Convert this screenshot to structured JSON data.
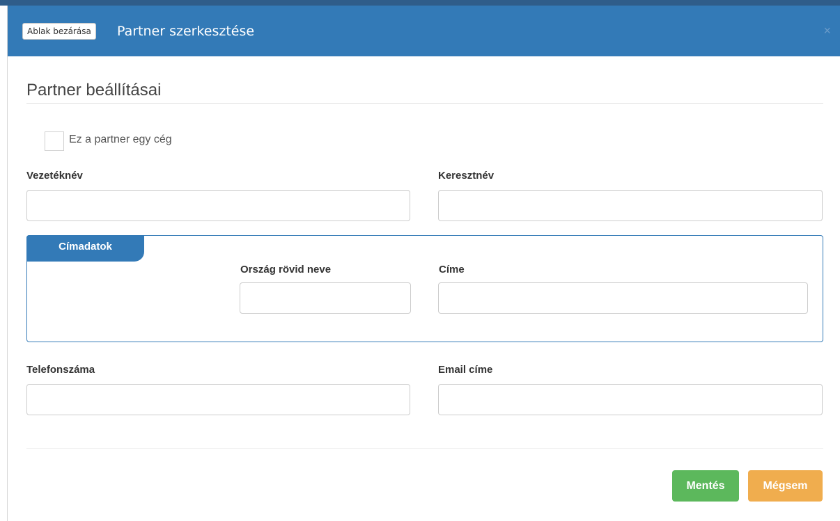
{
  "header": {
    "close_window_label": "Ablak bezárása",
    "title": "Partner szerkesztése",
    "close_symbol": "×"
  },
  "section": {
    "title": "Partner beállításai"
  },
  "company_checkbox": {
    "label": "Ez a partner egy cég",
    "checked": false
  },
  "fields": {
    "last_name": {
      "label": "Vezetéknév",
      "value": ""
    },
    "first_name": {
      "label": "Keresztnév",
      "value": ""
    },
    "phone": {
      "label": "Telefonszáma",
      "value": ""
    },
    "email": {
      "label": "Email címe",
      "value": ""
    }
  },
  "address": {
    "legend": "Címadatok",
    "country_short": {
      "label": "Ország rövid neve",
      "value": ""
    },
    "address": {
      "label": "Címe",
      "value": ""
    }
  },
  "buttons": {
    "save": "Mentés",
    "cancel": "Mégsem"
  },
  "colors": {
    "primary": "#337ab7",
    "success": "#5cb85c",
    "warning": "#f0ad4e"
  }
}
